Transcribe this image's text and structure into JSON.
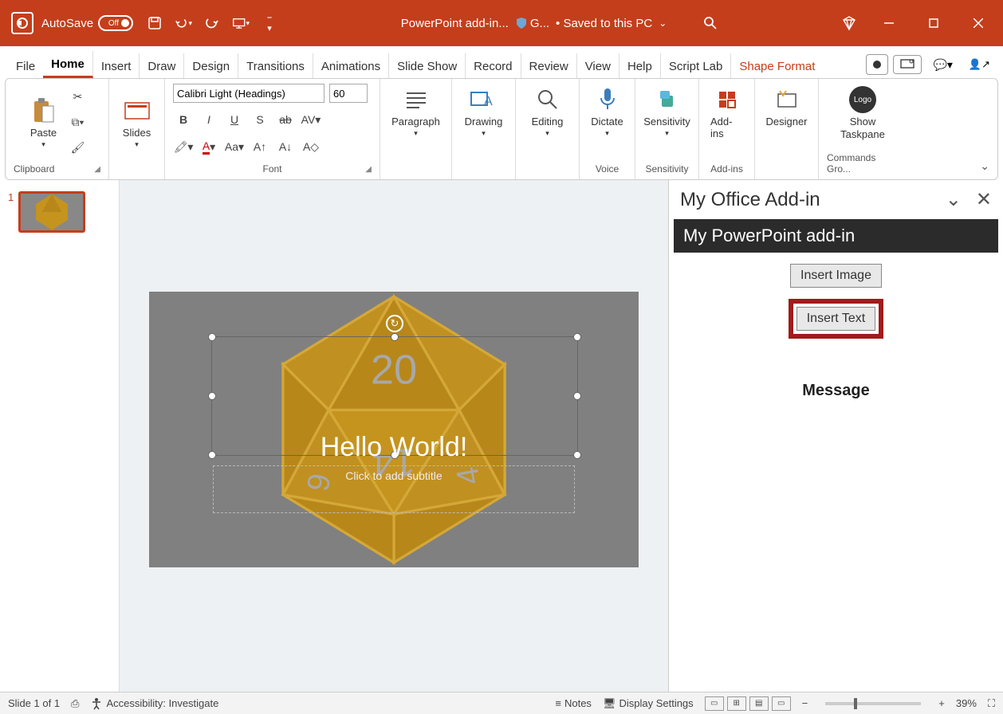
{
  "titlebar": {
    "autosave_label": "AutoSave",
    "autosave_state": "Off",
    "doc_name": "PowerPoint add-in...",
    "shield_label": "G...",
    "saved_status": "• Saved to this PC"
  },
  "tabs": {
    "items": [
      "File",
      "Home",
      "Insert",
      "Draw",
      "Design",
      "Transitions",
      "Animations",
      "Slide Show",
      "Record",
      "Review",
      "View",
      "Help",
      "Script Lab",
      "Shape Format"
    ],
    "active": "Home",
    "context_tabs": [
      "Shape Format"
    ]
  },
  "ribbon": {
    "clipboard": {
      "paste": "Paste",
      "label": "Clipboard"
    },
    "slides": {
      "label": "Slides",
      "btn": "Slides"
    },
    "font": {
      "label": "Font",
      "family": "Calibri Light (Headings)",
      "size": "60"
    },
    "paragraph": {
      "label": "Paragraph",
      "btn": "Paragraph"
    },
    "drawing": {
      "label": "Drawing",
      "btn": "Drawing"
    },
    "editing": {
      "label": "Editing",
      "btn": "Editing"
    },
    "voice": {
      "label": "Voice",
      "btn": "Dictate"
    },
    "sensitivity": {
      "label": "Sensitivity",
      "btn": "Sensitivity"
    },
    "addins": {
      "label": "Add-ins",
      "btn": "Add-ins"
    },
    "designer": {
      "label": "",
      "btn": "Designer"
    },
    "commands": {
      "label": "Commands Gro...",
      "btn": "Show Taskpane",
      "logo": "Logo"
    }
  },
  "slide": {
    "number": "1",
    "title": "Hello World!",
    "subtitle_placeholder": "Click to add subtitle"
  },
  "taskpane": {
    "header": "My Office Add-in",
    "title": "My PowerPoint add-in",
    "btn_image": "Insert Image",
    "btn_text": "Insert Text",
    "message_label": "Message"
  },
  "statusbar": {
    "slide_pos": "Slide 1 of 1",
    "accessibility": "Accessibility: Investigate",
    "notes": "Notes",
    "display": "Display Settings",
    "zoom": "39%"
  }
}
